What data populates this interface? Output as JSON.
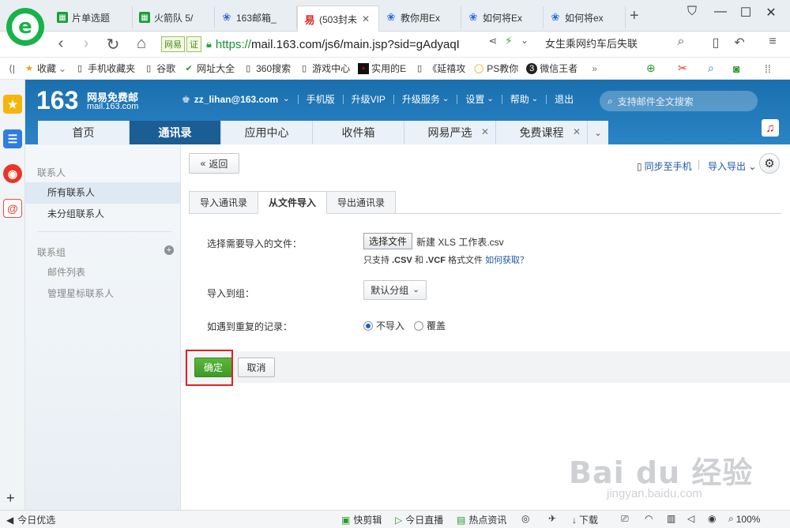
{
  "browser": {
    "tabs": [
      {
        "label": "片单选题",
        "icon": "green",
        "closable": false
      },
      {
        "label": "火箭队 5/",
        "icon": "green",
        "closable": false
      },
      {
        "label": "163邮箱_",
        "icon": "paw",
        "closable": false
      },
      {
        "label": "(503封未",
        "icon": "red163",
        "closable": true
      },
      {
        "label": "教你用Ex",
        "icon": "paw",
        "closable": false
      },
      {
        "label": "如何将Ex",
        "icon": "paw",
        "closable": false
      },
      {
        "label": "如何将ex",
        "icon": "paw",
        "closable": false
      }
    ],
    "new_tab": "+",
    "address": {
      "badge_site": "网易",
      "badge_cert": "证",
      "scheme": "https://",
      "host_path": "mail.163.com/js6/main.jsp?sid=gAdyaqI"
    },
    "search_text": "女生乘网约车后失联",
    "bookmarks": [
      {
        "label": "收藏",
        "icon": "star"
      },
      {
        "label": "手机收藏夹",
        "icon": "page"
      },
      {
        "label": "谷歌",
        "icon": "page"
      },
      {
        "label": "网址大全",
        "icon": "check"
      },
      {
        "label": "360搜索",
        "icon": "page"
      },
      {
        "label": "游戏中心",
        "icon": "page"
      },
      {
        "label": "实用的E",
        "icon": "black"
      },
      {
        "label": "《延禧攻",
        "icon": "page"
      },
      {
        "label": "PS教你",
        "icon": "circle"
      },
      {
        "label": "微信王者",
        "icon": "three"
      }
    ],
    "bookmarks_more": "»",
    "status": {
      "left": "今日优选",
      "items": [
        "快剪辑",
        "今日直播",
        "热点资讯",
        "下载"
      ],
      "zoom": "100%"
    }
  },
  "mail": {
    "logo_num": "163",
    "logo_cn": "网易免费邮",
    "logo_url": "mail.163.com",
    "user": "zz_lihan@163.com",
    "nav": [
      "手机版",
      "升级VIP",
      "升级服务",
      "设置",
      "帮助",
      "退出"
    ],
    "search_placeholder": "支持邮件全文搜索",
    "tabs": [
      {
        "label": "首页",
        "active": false,
        "closable": false
      },
      {
        "label": "通讯录",
        "active": true,
        "closable": false
      },
      {
        "label": "应用中心",
        "active": false,
        "closable": false
      },
      {
        "label": "收件箱",
        "active": false,
        "closable": false
      },
      {
        "label": "网易严选",
        "active": false,
        "closable": true
      },
      {
        "label": "免费课程",
        "active": false,
        "closable": true
      }
    ],
    "left": {
      "contacts_header": "联系人",
      "all_contacts": "所有联系人",
      "ungrouped": "未分组联系人",
      "groups_header": "联系组",
      "mail_list": "邮件列表",
      "manage_starred": "管理星标联系人"
    },
    "toolbar": {
      "back": "返回",
      "sync_phone": "同步至手机",
      "import_export": "导入导出"
    },
    "subtabs": [
      "导入通讯录",
      "从文件导入",
      "导出通讯录"
    ],
    "form": {
      "choose_label": "选择需要导入的文件：",
      "choose_button": "选择文件",
      "file_name": "新建 XLS 工作表.csv",
      "hint_prefix": "只支持",
      "hint_csv": ".CSV",
      "hint_and": "和",
      "hint_vcf": ".VCF",
      "hint_suffix": "格式文件",
      "hint_link": "如何获取？",
      "group_label": "导入到组：",
      "group_value": "默认分组",
      "dup_label": "如遇到重复的记录：",
      "dup_options": [
        "不导入",
        "覆盖"
      ],
      "dup_selected": 0
    },
    "actions": {
      "confirm": "确定",
      "cancel": "取消"
    }
  },
  "watermark": {
    "brand": "Bai du 经验",
    "url": "jingyan.baidu.com"
  }
}
